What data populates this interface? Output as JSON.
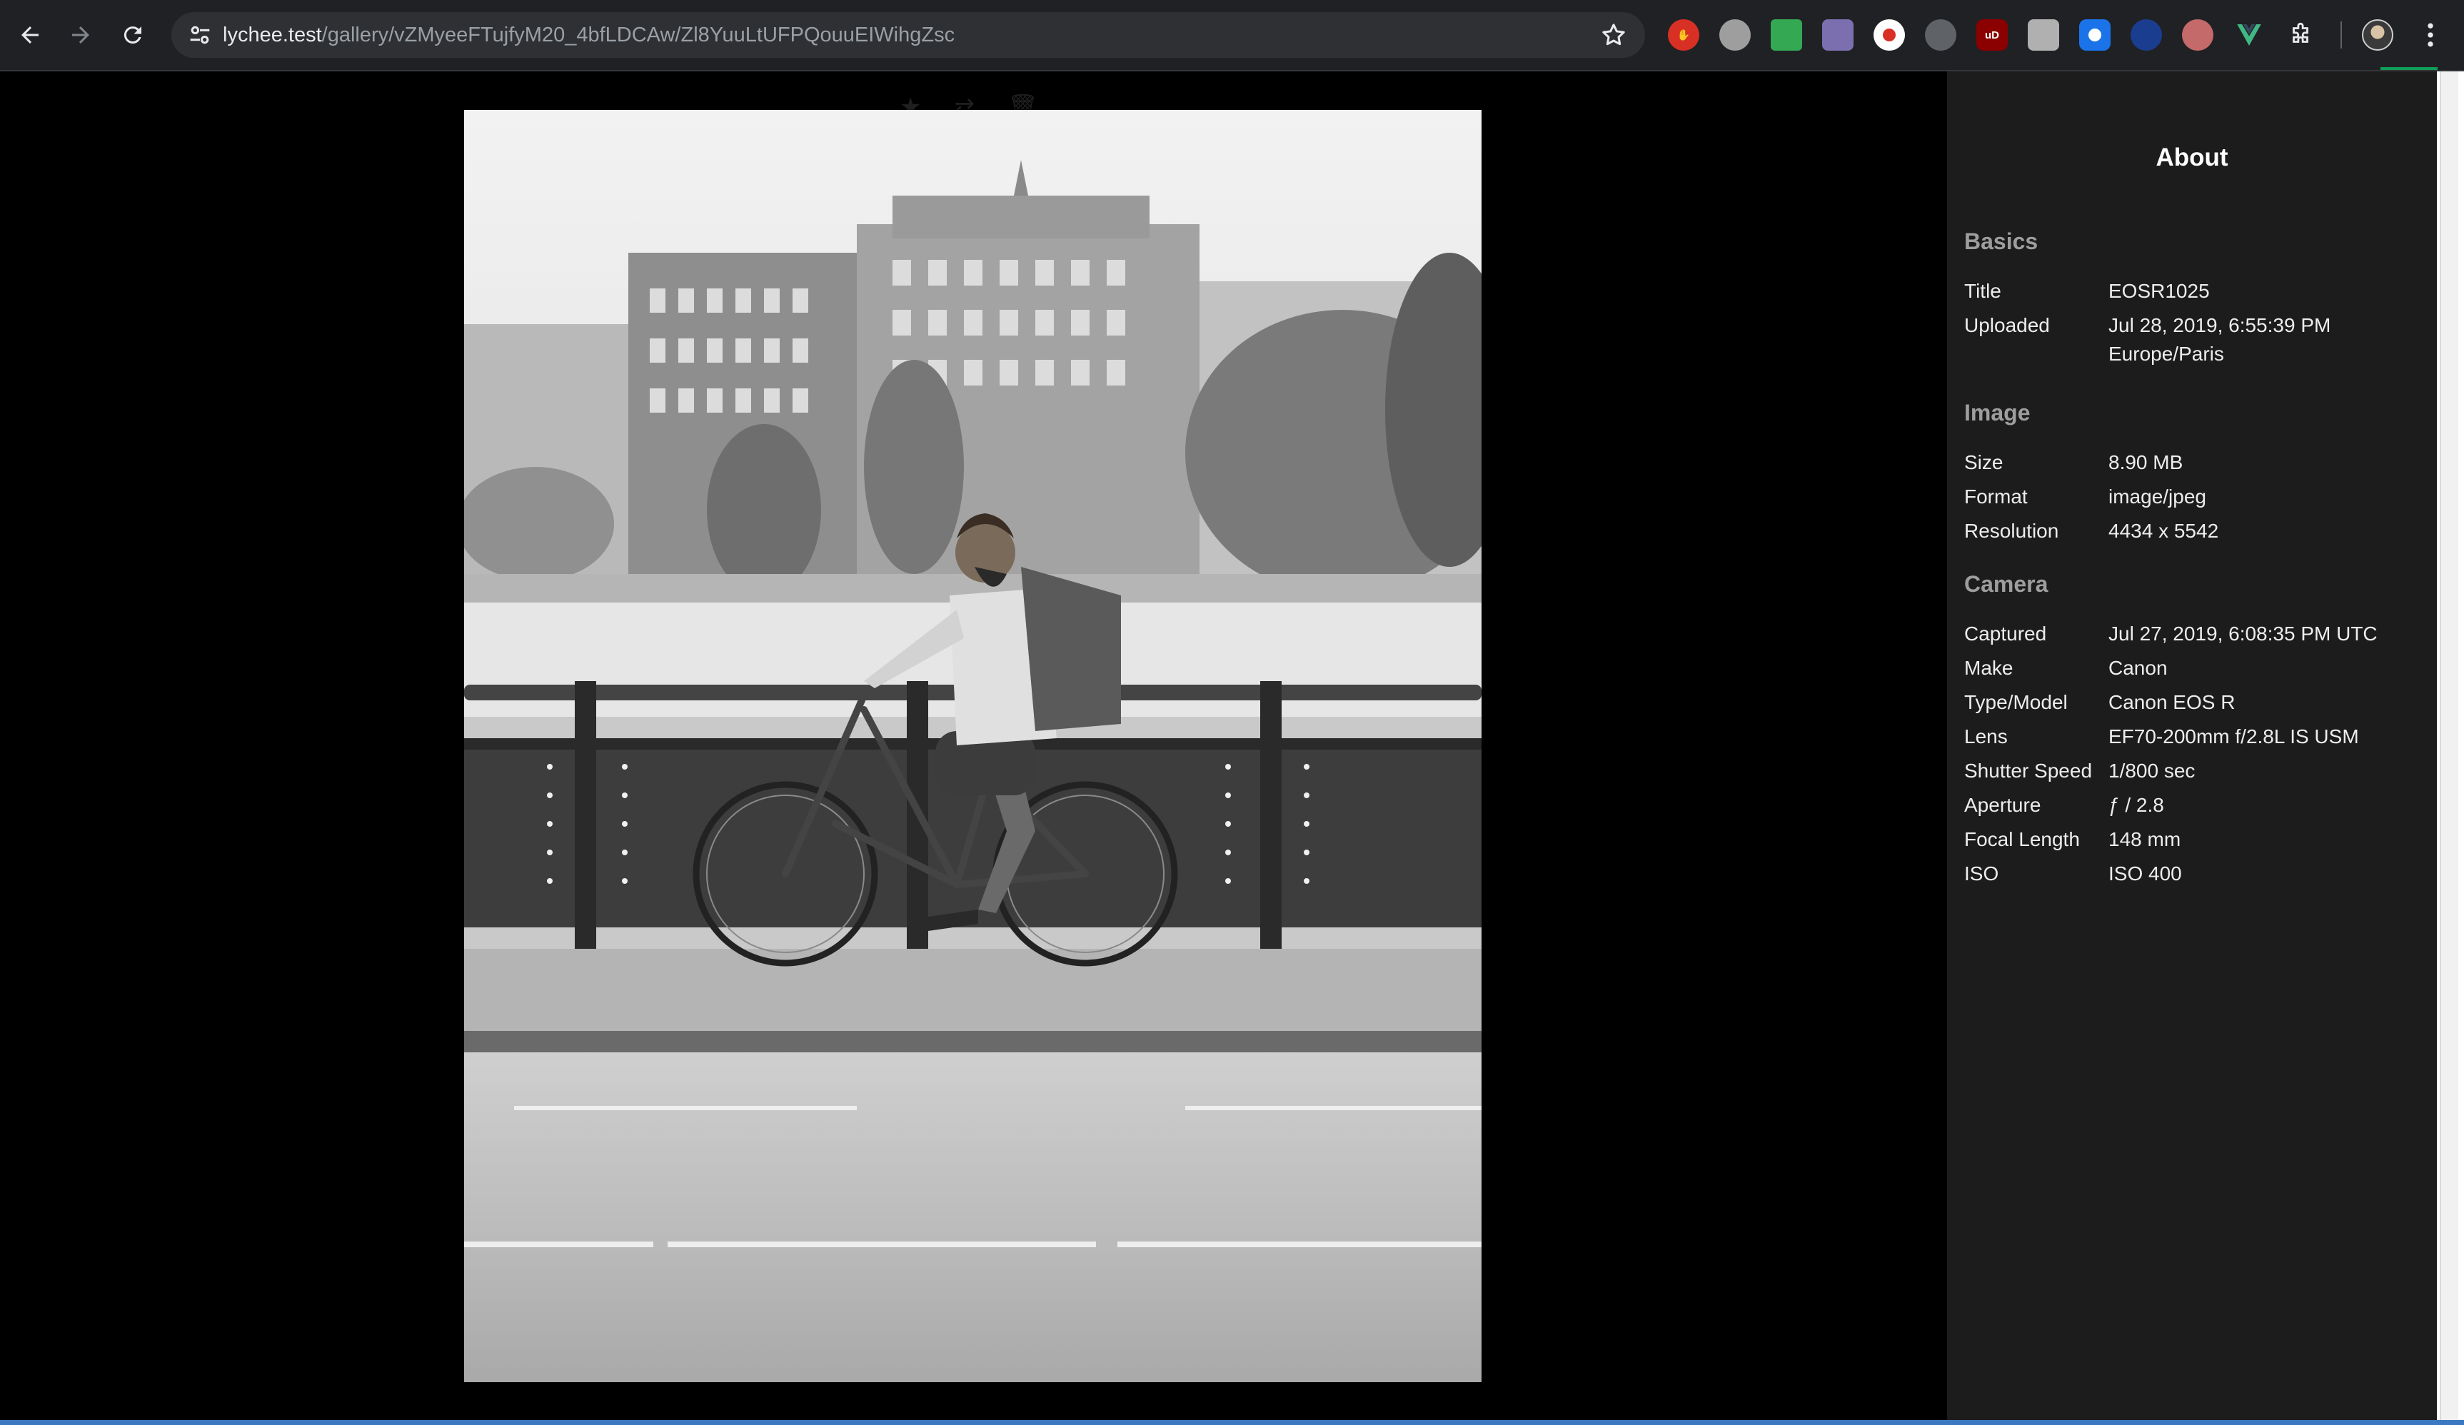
{
  "browser": {
    "url_host": "lychee.test",
    "url_path": "/gallery/vZMyeeFTujfyM20_4bfLDCAw/Zl8YuuLtUFPQouuEIWihgZsc",
    "extensions": [
      "red-hand-icon",
      "cookie-icon",
      "green-square-icon",
      "puzzle-cat-icon",
      "record-icon",
      "drop-icon",
      "ublock-icon",
      "shield-icon",
      "screenshot-icon",
      "eu-icon",
      "clockwork-icon",
      "vue-icon"
    ],
    "ublock_badge": "uD"
  },
  "viewer": {
    "overlay_tools": [
      "★",
      "⇄",
      "🗑"
    ]
  },
  "sidebar": {
    "title": "About",
    "basics": {
      "heading": "Basics",
      "rows": [
        {
          "label": "Title",
          "value": "EOSR1025"
        },
        {
          "label": "Uploaded",
          "value": "Jul 28, 2019, 6:55:39 PM",
          "value2": "Europe/Paris"
        }
      ]
    },
    "image": {
      "heading": "Image",
      "rows": [
        {
          "label": "Size",
          "value": "8.90 MB"
        },
        {
          "label": "Format",
          "value": "image/jpeg"
        },
        {
          "label": "Resolution",
          "value": "4434 x 5542"
        }
      ]
    },
    "camera": {
      "heading": "Camera",
      "rows": [
        {
          "label": "Captured",
          "value": "Jul 27, 2019, 6:08:35 PM UTC"
        },
        {
          "label": "Make",
          "value": "Canon"
        },
        {
          "label": "Type/Model",
          "value": "Canon EOS R"
        },
        {
          "label": "Lens",
          "value": "EF70-200mm f/2.8L IS USM"
        },
        {
          "label": "Shutter Speed",
          "value": "1/800 sec"
        },
        {
          "label": "Aperture",
          "value": "ƒ / 2.8"
        },
        {
          "label": "Focal Length",
          "value": "148 mm"
        },
        {
          "label": "ISO",
          "value": "ISO 400"
        }
      ]
    }
  },
  "colors": {
    "chrome_bg": "#202124",
    "sidebar_bg": "#1c1c1c",
    "viewer_bg": "#000000"
  }
}
